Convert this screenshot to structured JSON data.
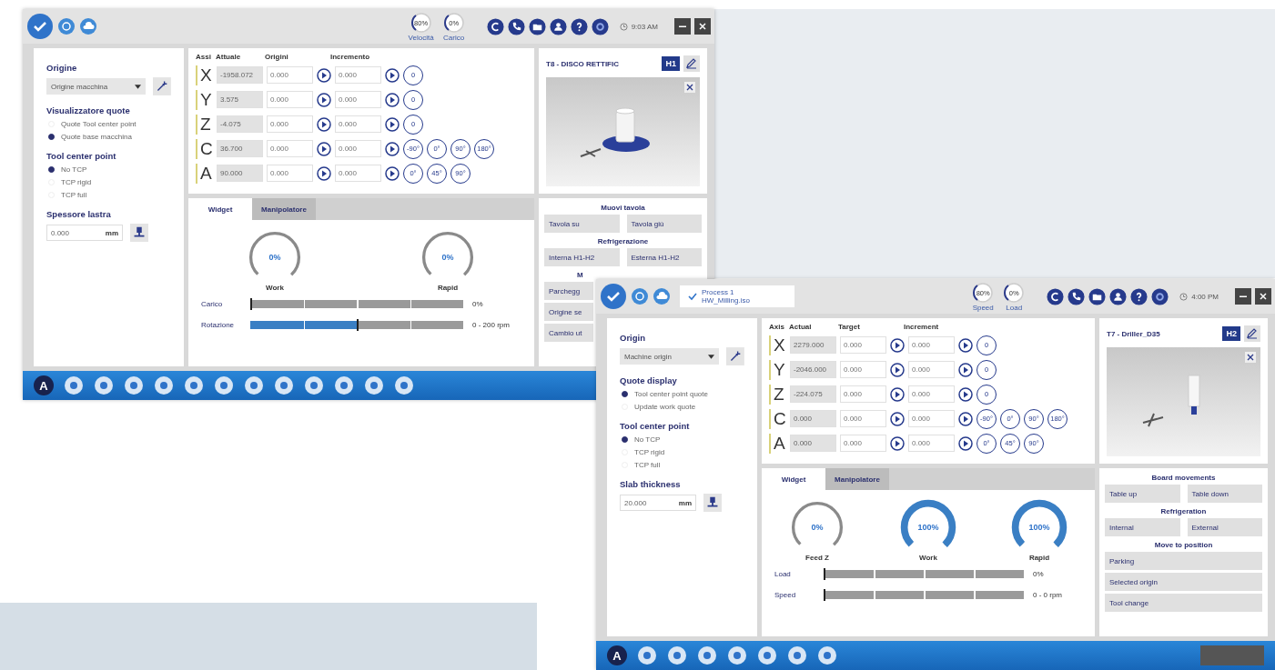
{
  "screens": [
    {
      "top_gauges": [
        {
          "value": "80%",
          "label": "Velocità"
        },
        {
          "value": "0%",
          "label": "Carico"
        }
      ],
      "clock": "9:03 AM",
      "origin": {
        "title": "Origine",
        "value": "Origine macchina"
      },
      "display": {
        "title": "Visualizzatore quote",
        "options": [
          {
            "label": "Quote Tool center point",
            "selected": false
          },
          {
            "label": "Quote base macchina",
            "selected": true
          }
        ]
      },
      "tcp": {
        "title": "Tool center point",
        "options": [
          {
            "label": "No TCP",
            "selected": true
          },
          {
            "label": "TCP rigid",
            "selected": false
          },
          {
            "label": "TCP full",
            "selected": false
          }
        ]
      },
      "thickness": {
        "title": "Spessore lastra",
        "value": "0.000",
        "unit": "mm"
      },
      "axes": {
        "columns": [
          "Assi",
          "Attuale",
          "Origini",
          "Incremento"
        ],
        "rows": [
          {
            "axis": "X",
            "actual": "-1958.072",
            "target": "0.000",
            "increment": "0.000",
            "presets": [
              "0"
            ]
          },
          {
            "axis": "Y",
            "actual": "3.575",
            "target": "0.000",
            "increment": "0.000",
            "presets": [
              "0"
            ]
          },
          {
            "axis": "Z",
            "actual": "-4.075",
            "target": "0.000",
            "increment": "0.000",
            "presets": [
              "0"
            ]
          },
          {
            "axis": "C",
            "actual": "36.700",
            "target": "0.000",
            "increment": "0.000",
            "presets": [
              "-90°",
              "0°",
              "90°",
              "180°"
            ]
          },
          {
            "axis": "A",
            "actual": "90.000",
            "target": "0.000",
            "increment": "0.000",
            "presets": [
              "0°",
              "45°",
              "90°"
            ]
          }
        ]
      },
      "tool": {
        "title": "T8 - DISCO RETTIFIC",
        "head": "H1",
        "kind": "disc"
      },
      "tabs": [
        {
          "label": "Widget",
          "selected": true
        },
        {
          "label": "Manipolatore",
          "selected": false
        }
      ],
      "gauges": [
        {
          "value": "0%",
          "label": "Work",
          "level": 0
        },
        {
          "value": "0%",
          "label": "Rapid",
          "level": 0
        }
      ],
      "bars": [
        {
          "label": "Carico",
          "level": 0,
          "reading": "0%"
        },
        {
          "label": "Rotazione",
          "level": 0.5,
          "reading": "0 - 200 rpm"
        }
      ],
      "actions": [
        {
          "title": "Muovi tavola",
          "kind": "pair",
          "buttons": [
            "Tavola su",
            "Tavola giù"
          ]
        },
        {
          "title": "Refrigerazione",
          "kind": "pair",
          "buttons": [
            "Interna H1-H2",
            "Esterna H1-H2"
          ]
        },
        {
          "title": "M",
          "kind": "cut",
          "buttons": [
            "Parchegg",
            "Origine se",
            "Cambio ut"
          ]
        }
      ],
      "taskbar_logo": "A"
    },
    {
      "notification": {
        "title": "Process 1",
        "file": "HW_Milling.iso"
      },
      "top_gauges": [
        {
          "value": "80%",
          "label": "Speed"
        },
        {
          "value": "0%",
          "label": "Load"
        }
      ],
      "clock": "4:00 PM",
      "origin": {
        "title": "Origin",
        "value": "Machine origin"
      },
      "display": {
        "title": "Quote display",
        "options": [
          {
            "label": "Tool center point quote",
            "selected": true
          },
          {
            "label": "Update work quote",
            "selected": false
          }
        ]
      },
      "tcp": {
        "title": "Tool center point",
        "options": [
          {
            "label": "No TCP",
            "selected": true
          },
          {
            "label": "TCP rigid",
            "selected": false
          },
          {
            "label": "TCP full",
            "selected": false
          }
        ]
      },
      "thickness": {
        "title": "Slab thickness",
        "value": "20.000",
        "unit": "mm"
      },
      "axes": {
        "columns": [
          "Axis",
          "Actual",
          "Target",
          "Increment"
        ],
        "rows": [
          {
            "axis": "X",
            "actual": "2279.000",
            "target": "0.000",
            "increment": "0.000",
            "presets": [
              "0"
            ]
          },
          {
            "axis": "Y",
            "actual": "-2046.000",
            "target": "0.000",
            "increment": "0.000",
            "presets": [
              "0"
            ]
          },
          {
            "axis": "Z",
            "actual": "-224.075",
            "target": "0.000",
            "increment": "0.000",
            "presets": [
              "0"
            ]
          },
          {
            "axis": "C",
            "actual": "0.000",
            "target": "0.000",
            "increment": "0.000",
            "presets": [
              "-90°",
              "0°",
              "90°",
              "180°"
            ]
          },
          {
            "axis": "A",
            "actual": "0.000",
            "target": "0.000",
            "increment": "0.000",
            "presets": [
              "0°",
              "45°",
              "90°"
            ]
          }
        ]
      },
      "tool": {
        "title": "T7 - Driller_D35",
        "head": "H2",
        "kind": "drill"
      },
      "tabs": [
        {
          "label": "Widget",
          "selected": true
        },
        {
          "label": "Manipolatore",
          "selected": false
        }
      ],
      "gauges": [
        {
          "value": "0%",
          "label": "Feed Z",
          "level": 0
        },
        {
          "value": "100%",
          "label": "Work",
          "level": 1
        },
        {
          "value": "100%",
          "label": "Rapid",
          "level": 1
        }
      ],
      "bars": [
        {
          "label": "Load",
          "level": 0,
          "reading": "0%"
        },
        {
          "label": "Speed",
          "level": 0,
          "reading": "0 - 0 rpm"
        }
      ],
      "actions": [
        {
          "title": "Board movements",
          "kind": "pair",
          "buttons": [
            "Table up",
            "Table down"
          ]
        },
        {
          "title": "Refrigeration",
          "kind": "pair",
          "buttons": [
            "Internal",
            "External"
          ]
        },
        {
          "title": "Move to position",
          "kind": "wide",
          "buttons": [
            "Parking",
            "Selected origin",
            "Tool change"
          ]
        }
      ],
      "taskbar_logo": "A"
    }
  ]
}
